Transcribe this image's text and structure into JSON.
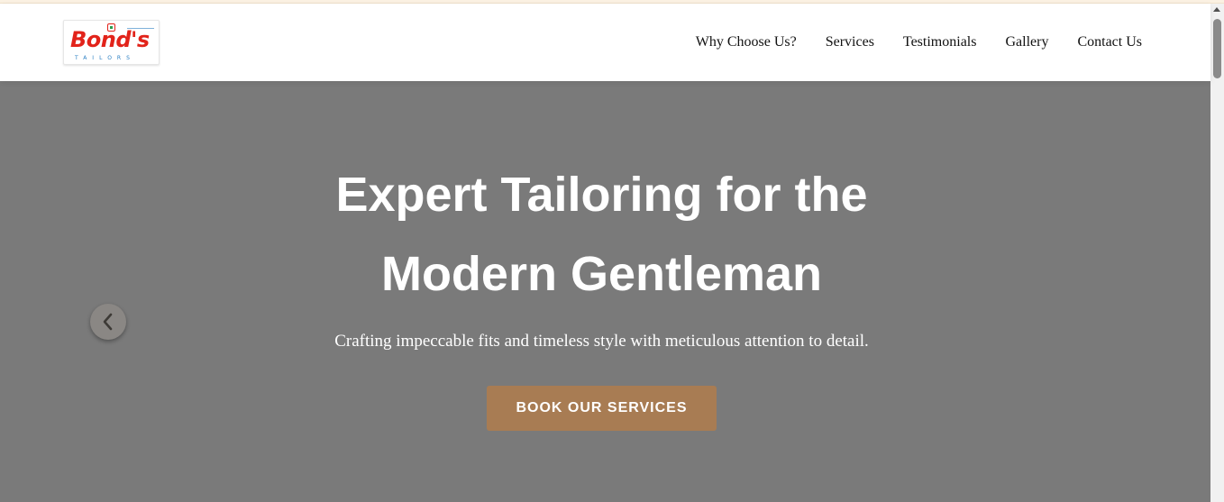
{
  "brand": {
    "logo_text": "Bond's",
    "logo_subtext": "TAILORS",
    "logo_color": "#e2231a",
    "logo_subtext_color": "#2a7fc3"
  },
  "nav": {
    "items": [
      {
        "label": "Why Choose Us?"
      },
      {
        "label": "Services"
      },
      {
        "label": "Testimonials"
      },
      {
        "label": "Gallery"
      },
      {
        "label": "Contact Us"
      }
    ]
  },
  "hero": {
    "title_line_1": "Expert Tailoring for the",
    "title_line_2": "Modern Gentleman",
    "subtitle": "Crafting impeccable fits and timeless style with meticulous attention to detail.",
    "cta_label": "BOOK OUR SERVICES",
    "background_color": "#7a7a7a",
    "cta_color": "#a87c53",
    "prev_icon": "chevron-left-icon"
  },
  "scrollbar": {
    "up_icon": "arrow-up-icon"
  }
}
